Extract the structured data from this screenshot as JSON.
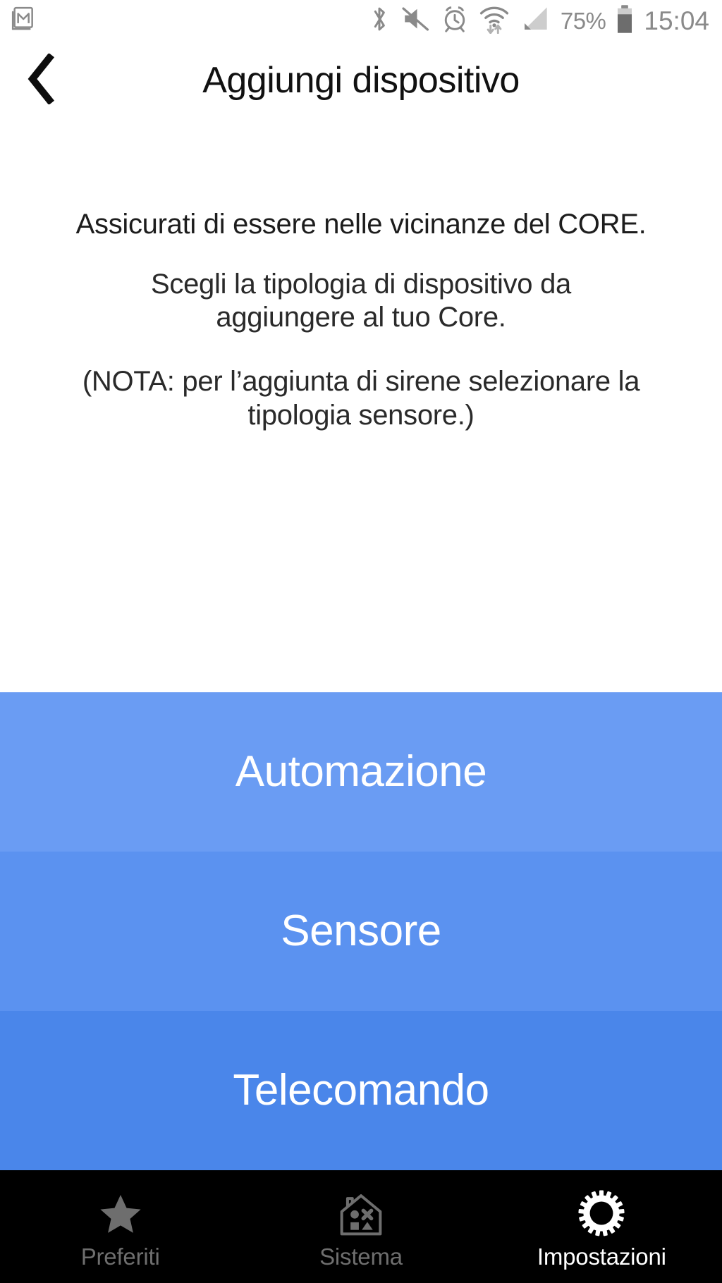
{
  "status_bar": {
    "notification_icon": "gmail-icon",
    "icons": [
      {
        "name": "bluetooth-icon"
      },
      {
        "name": "volume-muted-icon"
      },
      {
        "name": "alarm-clock-icon"
      },
      {
        "name": "wifi-data-transfer-icon"
      },
      {
        "name": "cellular-signal-icon"
      }
    ],
    "battery_percent": "75%",
    "battery_icon": "battery-icon",
    "clock": "15:04",
    "icon_color": "#8a8a8a"
  },
  "header": {
    "back_icon": "back-chevron-icon",
    "title": "Aggiungi dispositivo"
  },
  "content": {
    "lead": "Assicurati di essere nelle vicinanze del CORE.",
    "paragraph": "Scegli la tipologia di dispositivo da aggiungere al tuo Core.",
    "note": "(NOTA: per l’aggiunta di sirene selezionare la tipologia sensore.)"
  },
  "options": [
    {
      "label": "Automazione",
      "color": "#6A9CF3"
    },
    {
      "label": "Sensore",
      "color": "#5B92F0"
    },
    {
      "label": "Telecomando",
      "color": "#4A86EA"
    }
  ],
  "bottom_nav": {
    "items": [
      {
        "label": "Preferiti",
        "icon": "star-icon",
        "active": false
      },
      {
        "label": "Sistema",
        "icon": "house-shapes-icon",
        "active": false
      },
      {
        "label": "Impostazioni",
        "icon": "gear-icon",
        "active": true
      }
    ],
    "background": "#000000",
    "active_color": "#ffffff",
    "inactive_color": "#6e6e6e"
  }
}
